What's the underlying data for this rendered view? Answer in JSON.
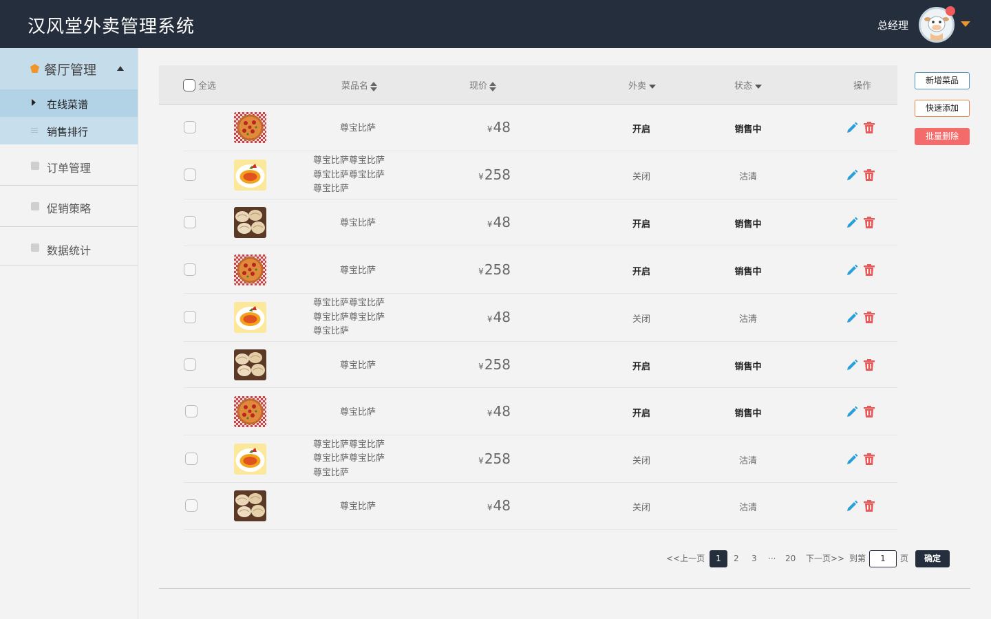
{
  "header": {
    "title": "汉风堂外卖管理系统",
    "user_name": "总经理"
  },
  "sidebar": {
    "main": {
      "label": "餐厅管理"
    },
    "subs": [
      {
        "label": "在线菜谱"
      },
      {
        "label": "销售排行"
      }
    ],
    "items": [
      {
        "label": "订单管理"
      },
      {
        "label": "促销策略"
      },
      {
        "label": "数据统计"
      }
    ]
  },
  "table": {
    "headers": {
      "select_all": "全选",
      "name": "菜品名",
      "price": "现价",
      "delivery": "外卖",
      "status": "状态",
      "action": "操作"
    },
    "rows": [
      {
        "image": "pizza-image",
        "name": "尊宝比萨",
        "price_symbol": "¥",
        "price": "48",
        "delivery": "开启",
        "status": "销售中"
      },
      {
        "image": "papaya-image",
        "name": "尊宝比萨尊宝比萨尊宝比萨尊宝比萨尊宝比萨",
        "price_symbol": "¥",
        "price": "258",
        "delivery": "关闭",
        "status": "沽清"
      },
      {
        "image": "dumpling-image",
        "name": "尊宝比萨",
        "price_symbol": "¥",
        "price": "48",
        "delivery": "开启",
        "status": "销售中"
      },
      {
        "image": "pizza-image",
        "name": "尊宝比萨",
        "price_symbol": "¥",
        "price": "258",
        "delivery": "开启",
        "status": "销售中"
      },
      {
        "image": "papaya-image",
        "name": "尊宝比萨尊宝比萨尊宝比萨尊宝比萨尊宝比萨",
        "price_symbol": "¥",
        "price": "48",
        "delivery": "关闭",
        "status": "沽清"
      },
      {
        "image": "dumpling-image",
        "name": "尊宝比萨",
        "price_symbol": "¥",
        "price": "258",
        "delivery": "开启",
        "status": "销售中"
      },
      {
        "image": "pizza-image",
        "name": "尊宝比萨",
        "price_symbol": "¥",
        "price": "48",
        "delivery": "开启",
        "status": "销售中"
      },
      {
        "image": "papaya-image",
        "name": "尊宝比萨尊宝比萨尊宝比萨尊宝比萨尊宝比萨",
        "price_symbol": "¥",
        "price": "258",
        "delivery": "关闭",
        "status": "沽清"
      },
      {
        "image": "dumpling-image",
        "name": "尊宝比萨",
        "price_symbol": "¥",
        "price": "48",
        "delivery": "关闭",
        "status": "沽清"
      }
    ]
  },
  "actions": {
    "add": "新增菜品",
    "quick_add": "快速添加",
    "batch_delete": "批量删除"
  },
  "pagination": {
    "prev": "<<上一页",
    "pages": [
      "1",
      "2",
      "3"
    ],
    "ellipsis": "···",
    "last": "20",
    "next": "下一页>>",
    "goto_prefix": "到第",
    "goto_value": "1",
    "goto_suffix": "页",
    "confirm": "确定"
  },
  "colors": {
    "header_bg": "#252e3d",
    "menu_active": "#b2d2e6",
    "delete_red": "#f36b6b",
    "edit_blue": "#2a9fd8",
    "caret_orange": "#f0952a"
  },
  "icons": {
    "edit": "pencil-icon",
    "delete": "trash-icon",
    "user_menu": "caret-down-icon",
    "menu_main": "leaf-icon"
  }
}
